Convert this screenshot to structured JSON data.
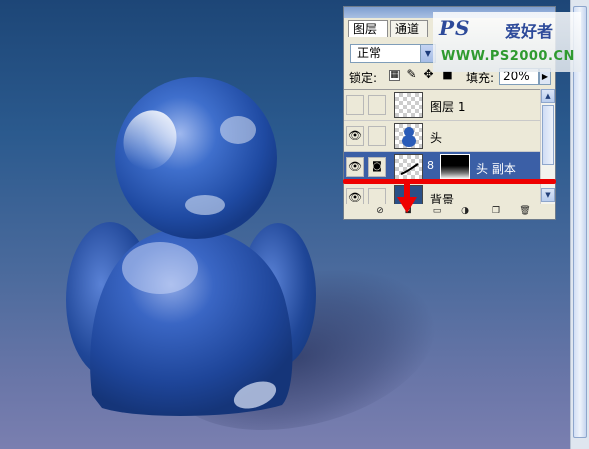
{
  "layers_panel": {
    "tabs": [
      {
        "label": "图层"
      },
      {
        "label": "通道"
      }
    ],
    "blend_mode": "正常",
    "lock_label": "锁定:",
    "fill_label": "填充:",
    "fill_value": "20%",
    "layers": [
      {
        "name": "图层 1",
        "visible": false,
        "selected": false
      },
      {
        "name": "头",
        "visible": true,
        "selected": false
      },
      {
        "name": "头 副本",
        "visible": true,
        "selected": true,
        "has_mask": true
      },
      {
        "name": "背景",
        "visible": true,
        "selected": false
      }
    ]
  },
  "watermark": {
    "logo": "PS",
    "text": "爱好者",
    "url": "WWW.PS2000.CN"
  },
  "icons": {
    "eye": "eye-icon",
    "brush": "brush-icon",
    "mask": "layer-mask-icon",
    "link": "link-icon",
    "new_layer": "new-layer-icon",
    "trash": "trash-icon",
    "arrow": "red-arrow-icon"
  },
  "colors": {
    "canvas_top": "#1d4677",
    "canvas_bottom": "#7a7fb0",
    "figure_blue": "#2a5cb8",
    "annotation_red": "#ee0000",
    "selected_layer": "#3b5fa6",
    "watermark_green": "#2f9a2f"
  }
}
